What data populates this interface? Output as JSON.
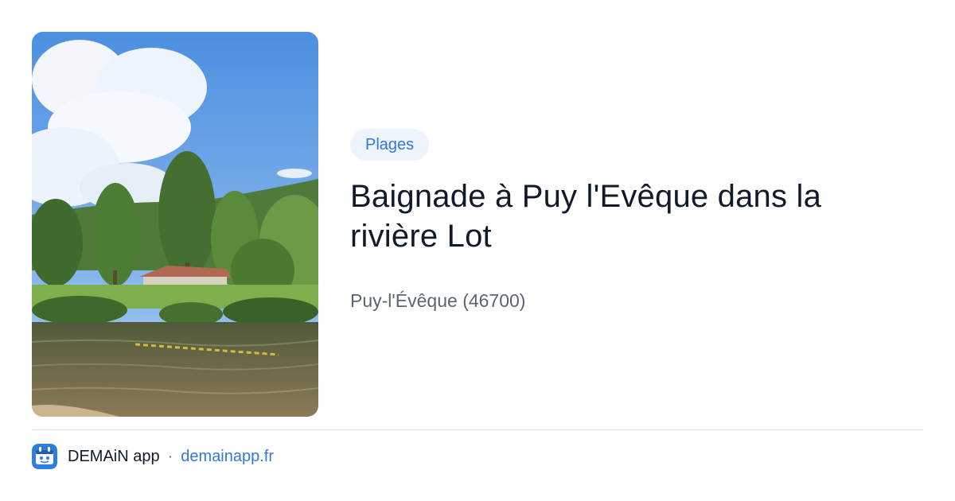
{
  "card": {
    "category": "Plages",
    "title": "Baignade à Puy l'Evêque dans la rivière Lot",
    "location": "Puy-l'Évêque (46700)"
  },
  "footer": {
    "app_name": "DEMAiN app",
    "separator": "·",
    "domain": "demainapp.fr"
  },
  "icons": {
    "app": "demain-app-logo-icon"
  },
  "colors": {
    "accent": "#3577d4",
    "badge_bg": "#edf4fd",
    "title": "#111a2b",
    "muted": "#5a6572"
  }
}
